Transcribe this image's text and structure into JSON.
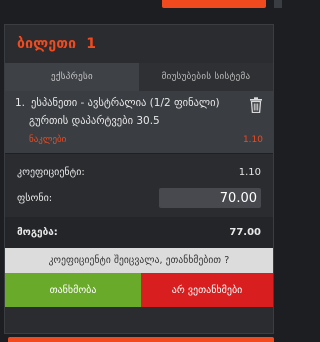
{
  "header": {
    "title": "ბილეთი",
    "count": "1"
  },
  "tabs": [
    {
      "label": "ექსპრესი",
      "active": true
    },
    {
      "label": "მიუსუბების სისტემა",
      "active": false
    }
  ],
  "selection": {
    "index": "1.",
    "event": "ესპანეთი - ავსტრალია (1/2 ფინალი)",
    "market": "გურთის დაპარტვები 30.5",
    "outcome": "ნაკლები",
    "odds": "1.10"
  },
  "summary": {
    "coef_label": "კოეფიციენტი:",
    "coef_value": "1.10",
    "stake_label": "ფსონი:",
    "stake_value": "70.00",
    "payout_label": "მოგება:",
    "payout_value": "77.00"
  },
  "confirm": {
    "question": "კოეფიციენტი შეიცვალა, ეთანხმებით ?",
    "accept_label": "თანხმობა",
    "decline_label": "არ ვეთანხმები"
  },
  "colors": {
    "accent": "#f04a1e",
    "accept": "#6aaa2a",
    "decline": "#d81e1e"
  }
}
